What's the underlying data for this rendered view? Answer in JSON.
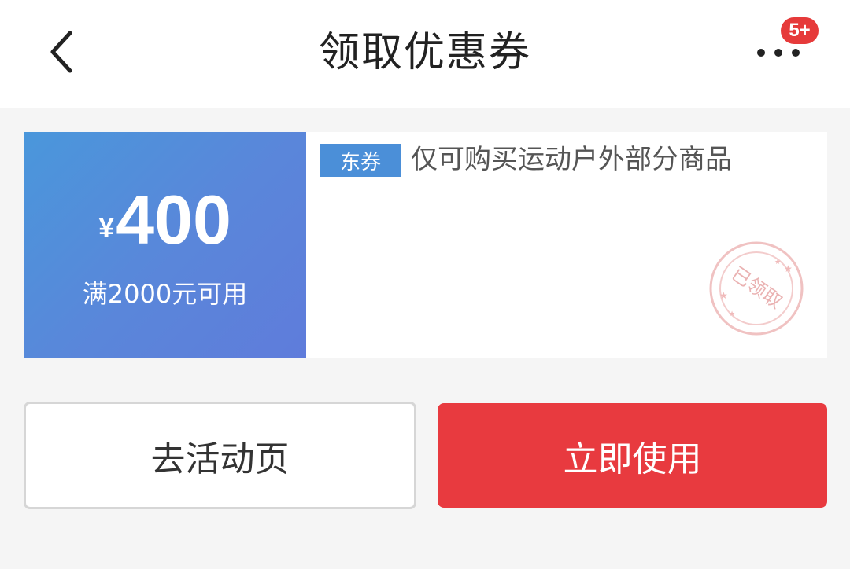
{
  "header": {
    "title": "领取优惠券",
    "badge_count": "5+"
  },
  "coupon": {
    "currency_symbol": "¥",
    "amount": "400",
    "condition": "满2000元可用",
    "tag": "东券",
    "description": "仅可购买运动户外部分商品",
    "stamp_text": "已领取"
  },
  "actions": {
    "activity_label": "去活动页",
    "use_now_label": "立即使用"
  },
  "colors": {
    "accent_red": "#e83a3f",
    "coupon_blue": "#4a97db",
    "badge_red": "#e63a3a"
  },
  "icons": [
    "back-arrow-icon",
    "more-dots-icon"
  ]
}
